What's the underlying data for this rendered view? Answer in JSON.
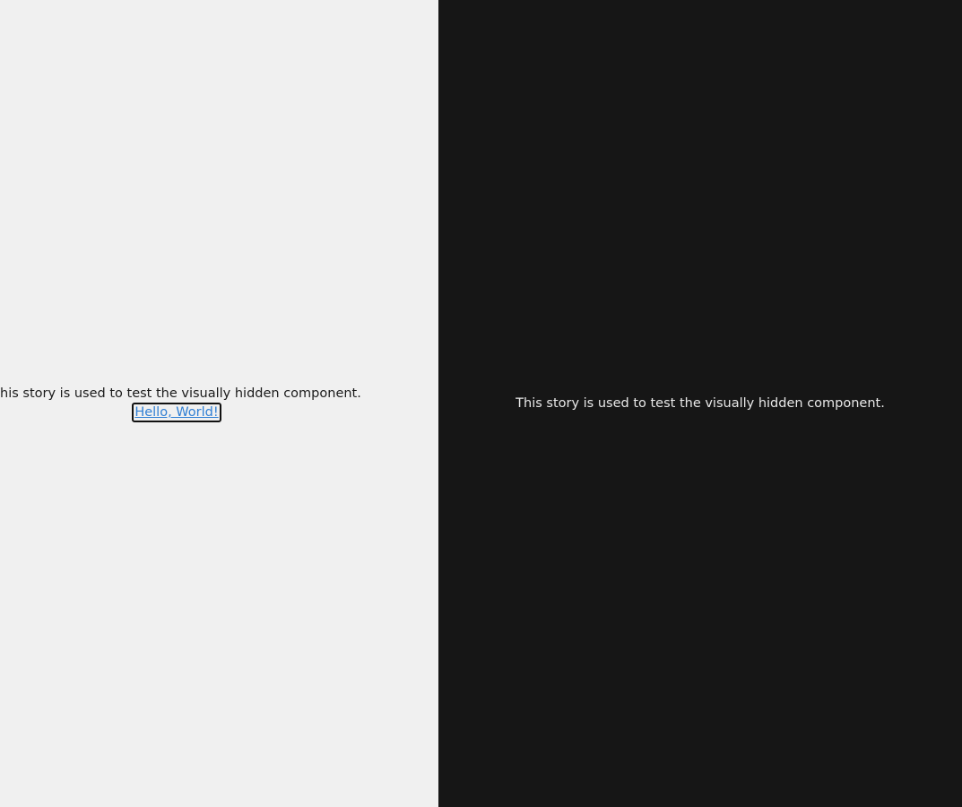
{
  "light_panel": {
    "story_text": "This story is used to test the visually hidden component.",
    "link_text": "Hello, World!"
  },
  "dark_panel": {
    "story_text": "This story is used to test the visually hidden component."
  },
  "colors": {
    "light_background": "#f0f0f0",
    "dark_background": "#161616",
    "link": "#2f7fd4"
  }
}
